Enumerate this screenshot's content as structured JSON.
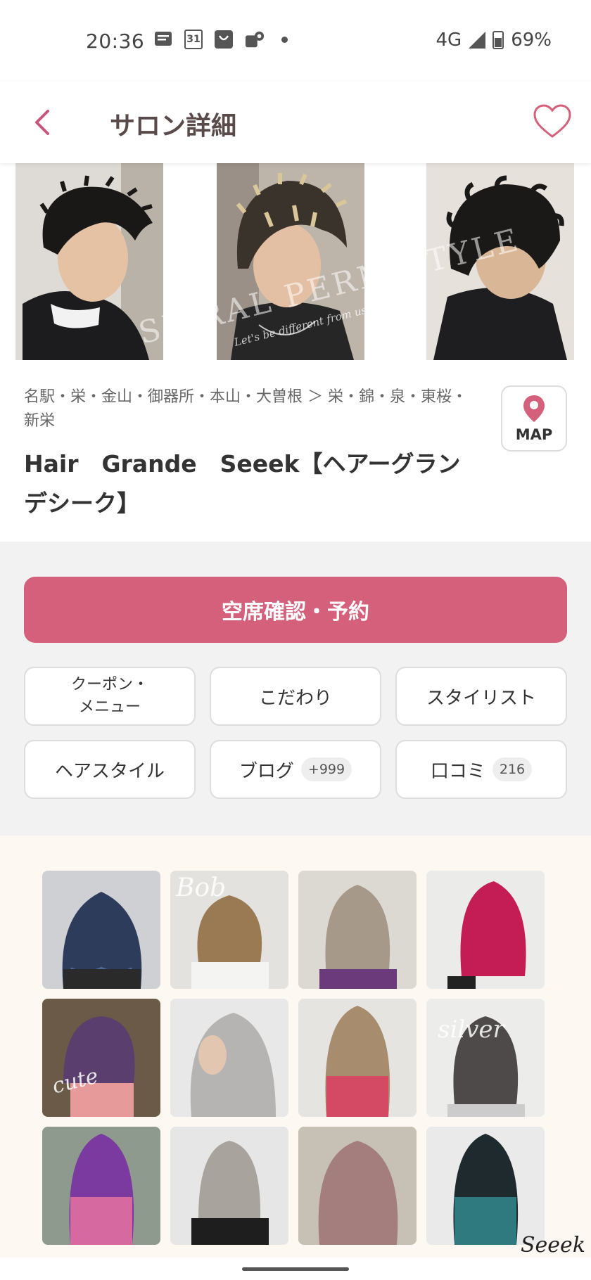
{
  "status_bar": {
    "time": "20:36",
    "calendar_day": "31",
    "network": "4G",
    "battery": "69%"
  },
  "header": {
    "title": "サロン詳細"
  },
  "hero": {
    "watermark_text": "SPIRAL PERM STYLE",
    "watermark_sub": "Let's be different from usual"
  },
  "salon": {
    "area": "名駅・栄・金山・御器所・本山・大曽根 ＞ 栄・錦・泉・東桜・新栄",
    "name": "Hair　Grande　Seeek【ヘアーグランデシーク】",
    "map_label": "MAP"
  },
  "actions": {
    "reserve_label": "空席確認・予約",
    "coupon_line1": "クーポン・",
    "coupon_line2": "メニュー",
    "kodawari": "こだわり",
    "stylist": "スタイリスト",
    "hairstyle": "ヘアスタイル",
    "blog": "ブログ",
    "blog_count": "+999",
    "review": "口コミ",
    "review_count": "216"
  },
  "gallery": {
    "label_bob": "Bob",
    "label_cute": "cute",
    "label_silver": "silver",
    "signature": "Seeek"
  },
  "colors": {
    "accent": "#d5607b",
    "header_text": "#5a4a4a",
    "action_bg": "#f2f2f2",
    "gallery_bg": "#fdf8f2"
  }
}
